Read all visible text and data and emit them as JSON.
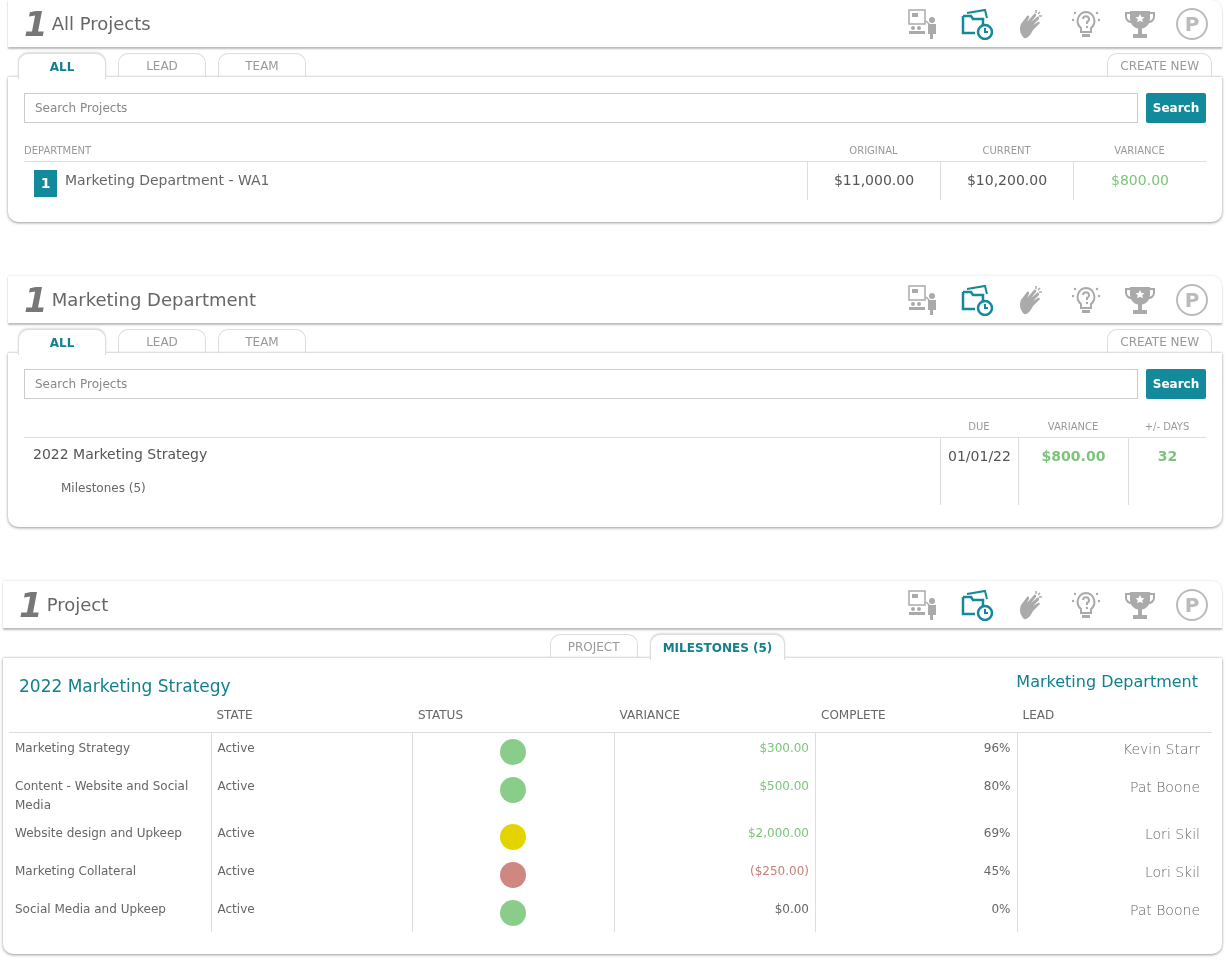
{
  "panels": [
    {
      "logo": "1",
      "title": "All Projects",
      "toolbar": [
        {
          "kind": "presentation",
          "selected": false
        },
        {
          "kind": "folder-clock",
          "selected": true
        },
        {
          "kind": "clap",
          "selected": false
        },
        {
          "kind": "bulb",
          "selected": false
        },
        {
          "kind": "trophy",
          "selected": false
        },
        {
          "kind": "letter",
          "glyph": "P",
          "selected": false
        }
      ],
      "tabs": [
        {
          "label": "ALL",
          "selected": true
        },
        {
          "label": "LEAD",
          "selected": false
        },
        {
          "label": "TEAM",
          "selected": false
        }
      ],
      "create_button": "CREATE NEW",
      "search": {
        "placeholder": "Search Projects",
        "button": "Search"
      },
      "kind": "departments",
      "columns": [
        "DEPARTMENT",
        "ORIGINAL",
        "CURRENT",
        "VARIANCE"
      ],
      "rows": [
        {
          "badge": "1",
          "name": "Marketing Department - WA1",
          "original": "$11,000.00",
          "current": "$10,200.00",
          "variance": {
            "text": "$800.00",
            "color": "#7cc47c"
          }
        }
      ]
    },
    {
      "logo": "1",
      "title": "Marketing Department",
      "toolbar": [
        {
          "kind": "presentation",
          "selected": false
        },
        {
          "kind": "folder-clock",
          "selected": true
        },
        {
          "kind": "clap",
          "selected": false
        },
        {
          "kind": "bulb",
          "selected": false
        },
        {
          "kind": "trophy",
          "selected": false
        },
        {
          "kind": "letter",
          "glyph": "P",
          "selected": false
        }
      ],
      "tabs": [
        {
          "label": "ALL",
          "selected": true
        },
        {
          "label": "LEAD",
          "selected": false
        },
        {
          "label": "TEAM",
          "selected": false
        }
      ],
      "create_button": "CREATE NEW",
      "search": {
        "placeholder": "Search Projects",
        "button": "Search"
      },
      "kind": "projects",
      "columns": [
        "DUE",
        "VARIANCE",
        "+/- DAYS"
      ],
      "rows": [
        {
          "name": "2022 Marketing Strategy",
          "sub": "Milestones (5)",
          "due": "01/01/22",
          "variance": {
            "text": "$800.00",
            "color": "#7cc47c"
          },
          "days": {
            "text": "32",
            "color": "#7cc47c"
          }
        }
      ]
    },
    {
      "logo": "1",
      "title": "Project",
      "toolbar": [
        {
          "kind": "presentation",
          "selected": false
        },
        {
          "kind": "folder-clock",
          "selected": true
        },
        {
          "kind": "clap",
          "selected": false
        },
        {
          "kind": "bulb",
          "selected": false
        },
        {
          "kind": "trophy",
          "selected": false
        },
        {
          "kind": "letter",
          "glyph": "P",
          "selected": false
        }
      ],
      "tabs": [
        {
          "label": "PROJECT",
          "selected": false
        },
        {
          "label": "MILESTONES (5)",
          "selected": true
        }
      ],
      "kind": "milestones",
      "project_title": "2022 Marketing Strategy",
      "department": "Marketing Department",
      "columns": [
        "STATE",
        "STATUS",
        "VARIANCE",
        "COMPLETE",
        "LEAD"
      ],
      "rows": [
        {
          "name": "Marketing Strategy",
          "state": "Active",
          "color": "#8acd8a",
          "variance": {
            "text": "$300.00",
            "color": "#7cc47c"
          },
          "complete": "96%",
          "lead": "Kevin Starr"
        },
        {
          "name": "Content - Website and Social Media",
          "state": "Active",
          "color": "#8acd8a",
          "variance": {
            "text": "$500.00",
            "color": "#7cc47c"
          },
          "complete": "80%",
          "lead": "Pat Boone"
        },
        {
          "name": "Website design and Upkeep",
          "state": "Active",
          "color": "#e3d400",
          "variance": {
            "text": "$2,000.00",
            "color": "#7cc47c"
          },
          "complete": "69%",
          "lead": "Lori Skil"
        },
        {
          "name": "Marketing Collateral",
          "state": "Active",
          "color": "#cf8781",
          "variance": {
            "text": "($250.00)",
            "color": "#c48078"
          },
          "complete": "45%",
          "lead": "Lori Skil"
        },
        {
          "name": "Social Media and Upkeep",
          "state": "Active",
          "color": "#8acd8a",
          "variance": {
            "text": "$0.00",
            "color": "#666666"
          },
          "complete": "0%",
          "lead": "Pat Boone"
        }
      ]
    }
  ]
}
